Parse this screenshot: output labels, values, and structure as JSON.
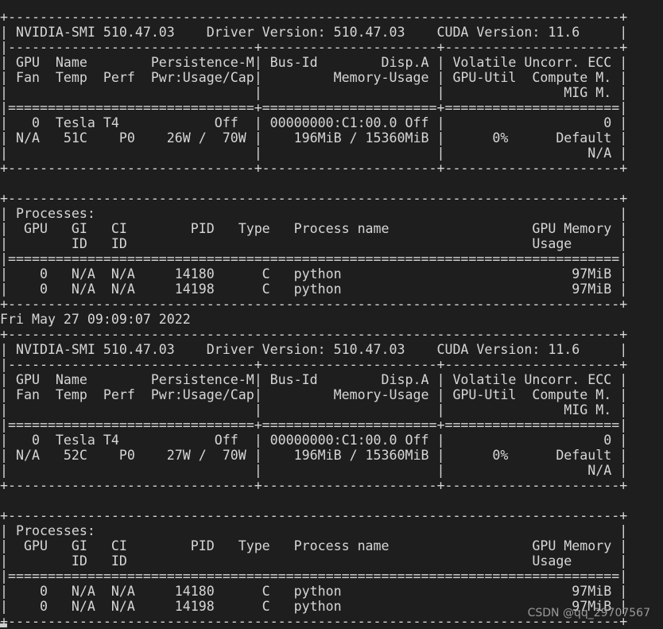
{
  "terminal": {
    "lines": [
      "+-----------------------------------------------------------------------------+",
      "| NVIDIA-SMI 510.47.03    Driver Version: 510.47.03    CUDA Version: 11.6     |",
      "|-------------------------------+----------------------+----------------------+",
      "| GPU  Name        Persistence-M| Bus-Id        Disp.A | Volatile Uncorr. ECC |",
      "| Fan  Temp  Perf  Pwr:Usage/Cap|         Memory-Usage | GPU-Util  Compute M. |",
      "|                               |                      |               MIG M. |",
      "|===============================+======================+======================|",
      "|   0  Tesla T4            Off  | 00000000:C1:00.0 Off |                    0 |",
      "| N/A   51C    P0    26W /  70W |    196MiB / 15360MiB |      0%      Default |",
      "|                               |                      |                  N/A |",
      "+-------------------------------+----------------------+----------------------+",
      "                                                                               ",
      "+-----------------------------------------------------------------------------+",
      "| Processes:                                                                  |",
      "|  GPU   GI   CI        PID   Type   Process name                  GPU Memory |",
      "|        ID   ID                                                   Usage      |",
      "|=============================================================================|",
      "|    0   N/A  N/A     14180      C   python                             97MiB |",
      "|    0   N/A  N/A     14198      C   python                             97MiB |",
      "+-----------------------------------------------------------------------------+",
      "Fri May 27 09:09:07 2022",
      "+-----------------------------------------------------------------------------+",
      "| NVIDIA-SMI 510.47.03    Driver Version: 510.47.03    CUDA Version: 11.6     |",
      "|-------------------------------+----------------------+----------------------+",
      "| GPU  Name        Persistence-M| Bus-Id        Disp.A | Volatile Uncorr. ECC |",
      "| Fan  Temp  Perf  Pwr:Usage/Cap|         Memory-Usage | GPU-Util  Compute M. |",
      "|                               |                      |               MIG M. |",
      "|===============================+======================+======================|",
      "|   0  Tesla T4            Off  | 00000000:C1:00.0 Off |                    0 |",
      "| N/A   52C    P0    27W /  70W |    196MiB / 15360MiB |      0%      Default |",
      "|                               |                      |                  N/A |",
      "+-------------------------------+----------------------+----------------------+",
      "                                                                               ",
      "+-----------------------------------------------------------------------------+",
      "| Processes:                                                                  |",
      "|  GPU   GI   CI        PID   Type   Process name                  GPU Memory |",
      "|        ID   ID                                                   Usage      |",
      "|=============================================================================|",
      "|    0   N/A  N/A     14180      C   python                             97MiB |",
      "|    0   N/A  N/A     14198      C   python                             97MiB |",
      "+-----------------------------------------------------------------------------+"
    ]
  },
  "watermark": "CSDN @qq_29707567"
}
